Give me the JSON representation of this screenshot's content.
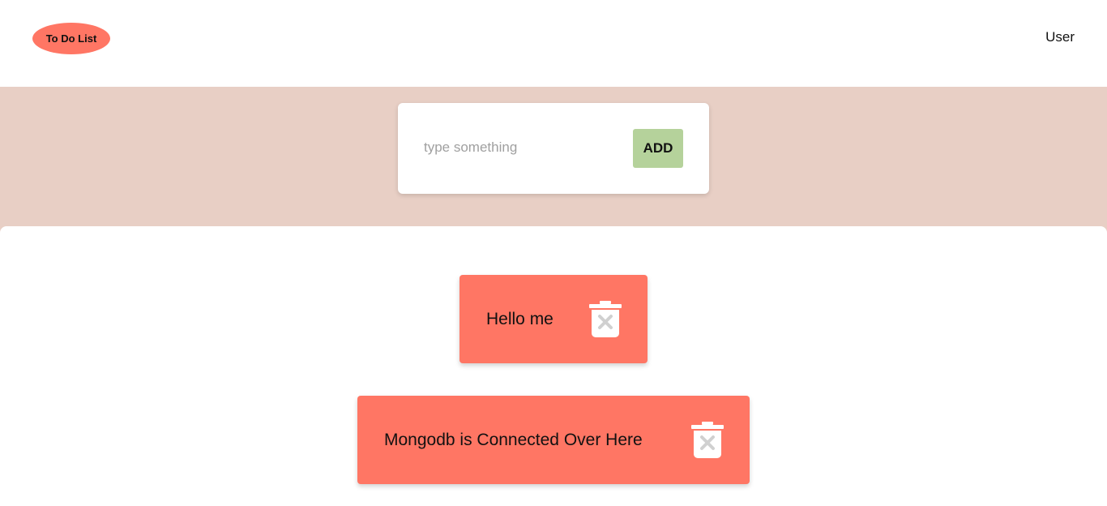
{
  "navbar": {
    "logo_text": "To Do List",
    "user_label": "User"
  },
  "input_card": {
    "placeholder": "type something",
    "value": "",
    "add_label": "ADD"
  },
  "todos": [
    {
      "text": "Hello me",
      "delete_icon": "trash-x-icon"
    },
    {
      "text": "Mongodb is Connected Over Here",
      "delete_icon": "trash-x-icon"
    }
  ],
  "colors": {
    "accent": "#ff7664",
    "hero_bg": "#e8cfc5",
    "add_button": "#b5d29b"
  }
}
